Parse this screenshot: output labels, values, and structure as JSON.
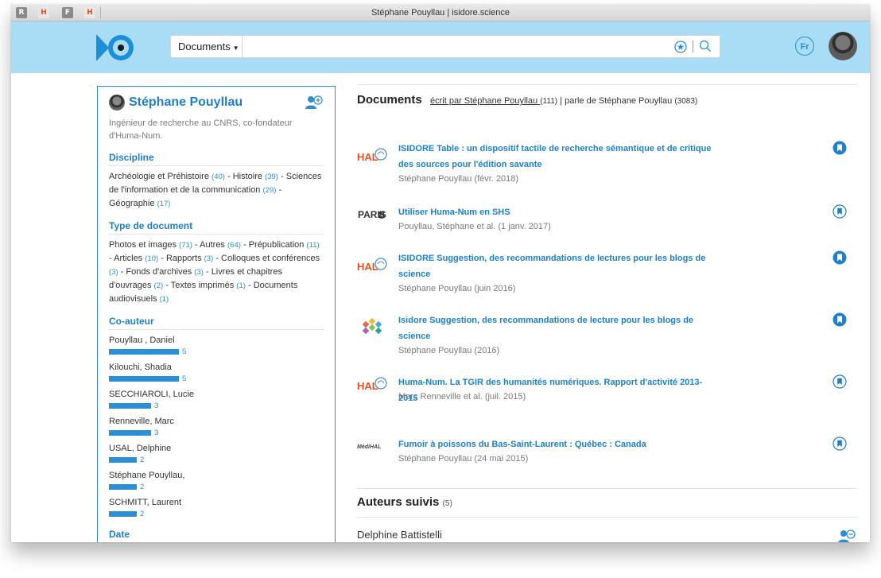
{
  "window": {
    "title": "Stéphane Pouyllau | isidore.science"
  },
  "extensions": [
    "R",
    "H",
    "F",
    "H"
  ],
  "header": {
    "search_type": "Documents",
    "search_placeholder": "",
    "lang": "Fr"
  },
  "profile": {
    "name": "Stéphane Pouyllau",
    "description": "Ingénieur de recherche au CNRS, co-fondateur d'Huma-Num.",
    "facets": {
      "discipline_title": "Discipline",
      "disciplines": [
        {
          "label": "Archéologie et Préhistoire",
          "count": "(40)"
        },
        {
          "label": "Histoire",
          "count": "(39)"
        },
        {
          "label": "Sciences de l'information et de la communication",
          "count": "(29)"
        },
        {
          "label": "Géographie",
          "count": "(17)"
        }
      ],
      "type_title": "Type de document",
      "types": [
        {
          "label": "Photos et images",
          "count": "(71)"
        },
        {
          "label": "Autres",
          "count": "(64)"
        },
        {
          "label": "Prépublication",
          "count": "(11)"
        },
        {
          "label": "Articles",
          "count": "(10)"
        },
        {
          "label": "Rapports",
          "count": "(3)"
        },
        {
          "label": "Colloques et conférences",
          "count": "(3)"
        },
        {
          "label": "Fonds d'archives",
          "count": "(3)"
        },
        {
          "label": "Livres et chapitres d'ouvrages",
          "count": "(2)"
        },
        {
          "label": "Textes imprimés",
          "count": "(1)"
        },
        {
          "label": "Documents audiovisuels",
          "count": "(1)"
        }
      ],
      "coauthor_title": "Co-auteur",
      "coauthors": [
        {
          "name": "Pouyllau , Daniel",
          "count": "5",
          "value": 5
        },
        {
          "name": "Kilouchi, Shadia",
          "count": "5",
          "value": 5
        },
        {
          "name": "SECCHIAROLI, Lucie",
          "count": "3",
          "value": 3
        },
        {
          "name": "Renneville, Marc",
          "count": "3",
          "value": 3
        },
        {
          "name": "USAL, Delphine",
          "count": "2",
          "value": 2
        },
        {
          "name": "Stéphane Pouyllau,",
          "count": "2",
          "value": 2
        },
        {
          "name": "SCHMITT, Laurent",
          "count": "2",
          "value": 2
        }
      ],
      "date_title": "Date"
    }
  },
  "documents": {
    "title": "Documents",
    "written_by": "écrit par Stéphane Pouyllau",
    "written_count": "(111)",
    "separator": "|",
    "about": "parle de Stéphane Pouyllau",
    "about_count": "(3083)",
    "items": [
      {
        "source": "HAL",
        "title": "ISIDORE Table : un dispositif tactile de recherche sémantique et de critique des sources pour l'édition savante",
        "meta": "Stéphane Pouyllau (févr. 2018)",
        "bookmarked": true
      },
      {
        "source": "PARIS8",
        "title": "Utiliser Huma-Num en SHS",
        "meta": "Pouyllau, Stéphane et al. (1 janv. 2017)",
        "bookmarked": false
      },
      {
        "source": "HAL",
        "title": "ISIDORE Suggestion, des recommandations de lectures pour les blogs de science",
        "meta": "Stéphane Pouyllau (juin 2016)",
        "bookmarked": true
      },
      {
        "source": "isidore",
        "title": "Isidore Suggestion, des recommandations de lecture pour les blogs de science",
        "meta": "Stéphane Pouyllau (2016)",
        "bookmarked": true
      },
      {
        "source": "HAL",
        "title": "Huma-Num. La TGIR des humanités numériques. Rapport d'activité 2013-2015",
        "meta": "Marc Renneville et al. (juil. 2015)",
        "bookmarked": false
      },
      {
        "source": "MédiHAL",
        "title": "Fumoir à poissons du Bas-Saint-Laurent : Québec : Canada",
        "meta": "Stéphane Pouyllau (24 mai 2015)",
        "bookmarked": false
      }
    ]
  },
  "following": {
    "title": "Auteurs suivis",
    "count": "(5)",
    "authors": [
      "Delphine Battistelli"
    ]
  },
  "colors": {
    "accent": "#1e7fcb",
    "header_bg": "#a9ddf5",
    "hal_orange": "#e5501e"
  }
}
